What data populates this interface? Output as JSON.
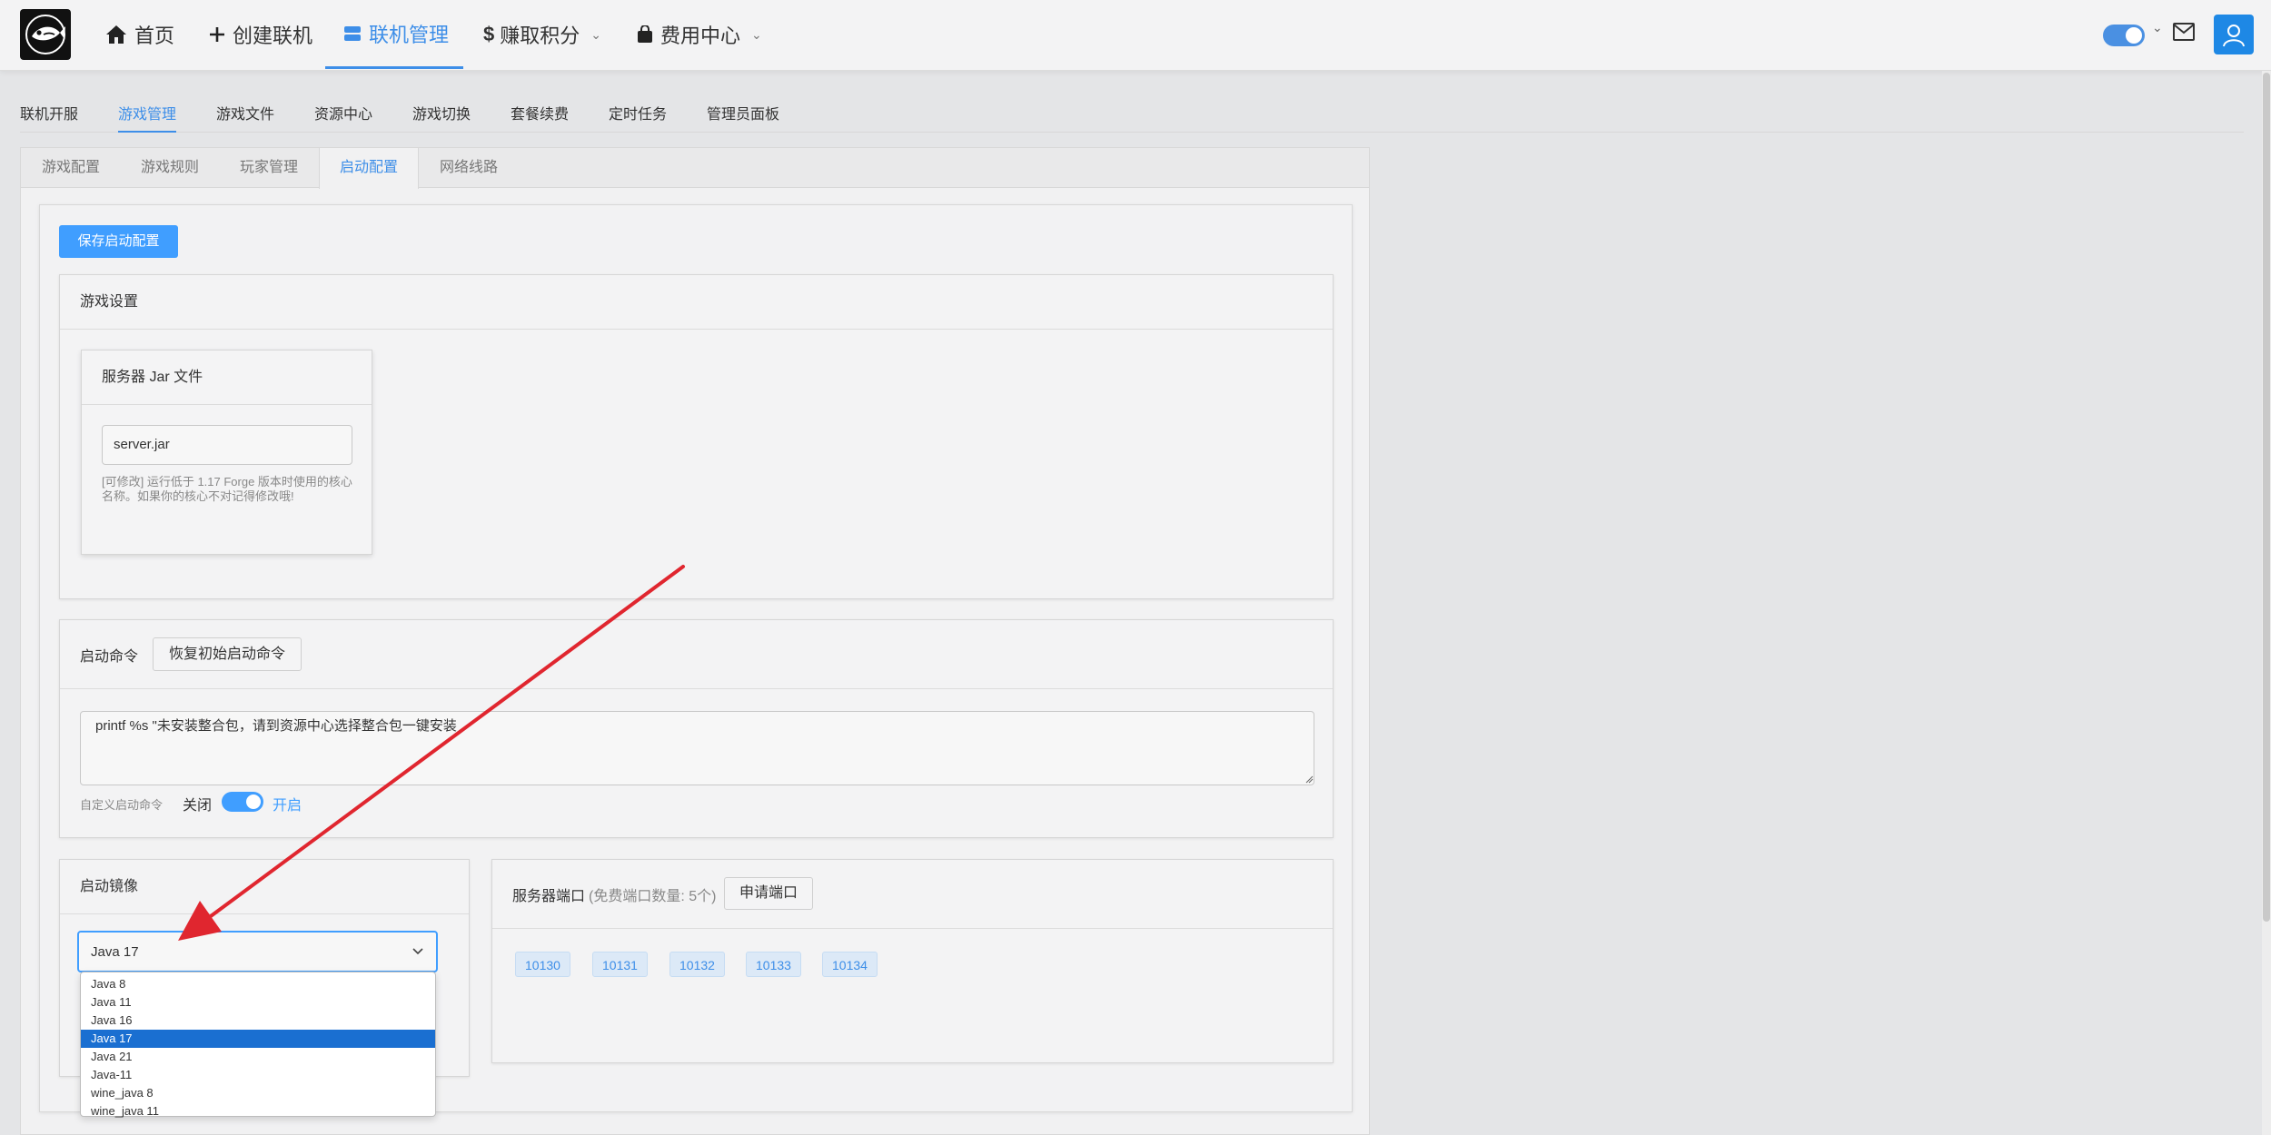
{
  "nav": {
    "home": "首页",
    "create": "创建联机",
    "manage": "联机管理",
    "earn": "赚取积分",
    "fees": "费用中心"
  },
  "subtabs": [
    "联机开服",
    "游戏管理",
    "游戏文件",
    "资源中心",
    "游戏切换",
    "套餐续费",
    "定时任务",
    "管理员面板"
  ],
  "tabs": [
    "游戏配置",
    "游戏规则",
    "玩家管理",
    "启动配置",
    "网络线路"
  ],
  "save_button": "保存启动配置",
  "game_settings": {
    "title": "游戏设置",
    "jar_card_title": "服务器 Jar 文件",
    "jar_value": "server.jar",
    "jar_hint": "[可修改] 运行低于 1.17 Forge 版本时使用的核心名称。如果你的核心不对记得修改哦!"
  },
  "launch_command": {
    "title": "启动命令",
    "reset_button": "恢复初始启动命令",
    "value": "printf %s \"未安装整合包，请到资源中心选择整合包一键安装",
    "custom_label": "自定义启动命令",
    "off_label": "关闭",
    "on_label": "开启",
    "enabled": true
  },
  "launch_image": {
    "title": "启动镜像",
    "selected": "Java 17",
    "options": [
      "Java 8",
      "Java 11",
      "Java 16",
      "Java 17",
      "Java 21",
      "Java-11",
      "wine_java 8",
      "wine_java 11"
    ]
  },
  "ports": {
    "title": "服务器端口",
    "free_note": "(免费端口数量: 5个)",
    "apply_button": "申请端口",
    "list": [
      "10130",
      "10131",
      "10132",
      "10133",
      "10134"
    ]
  },
  "colors": {
    "accent": "#409eff",
    "annotation_arrow": "#e0262f"
  }
}
